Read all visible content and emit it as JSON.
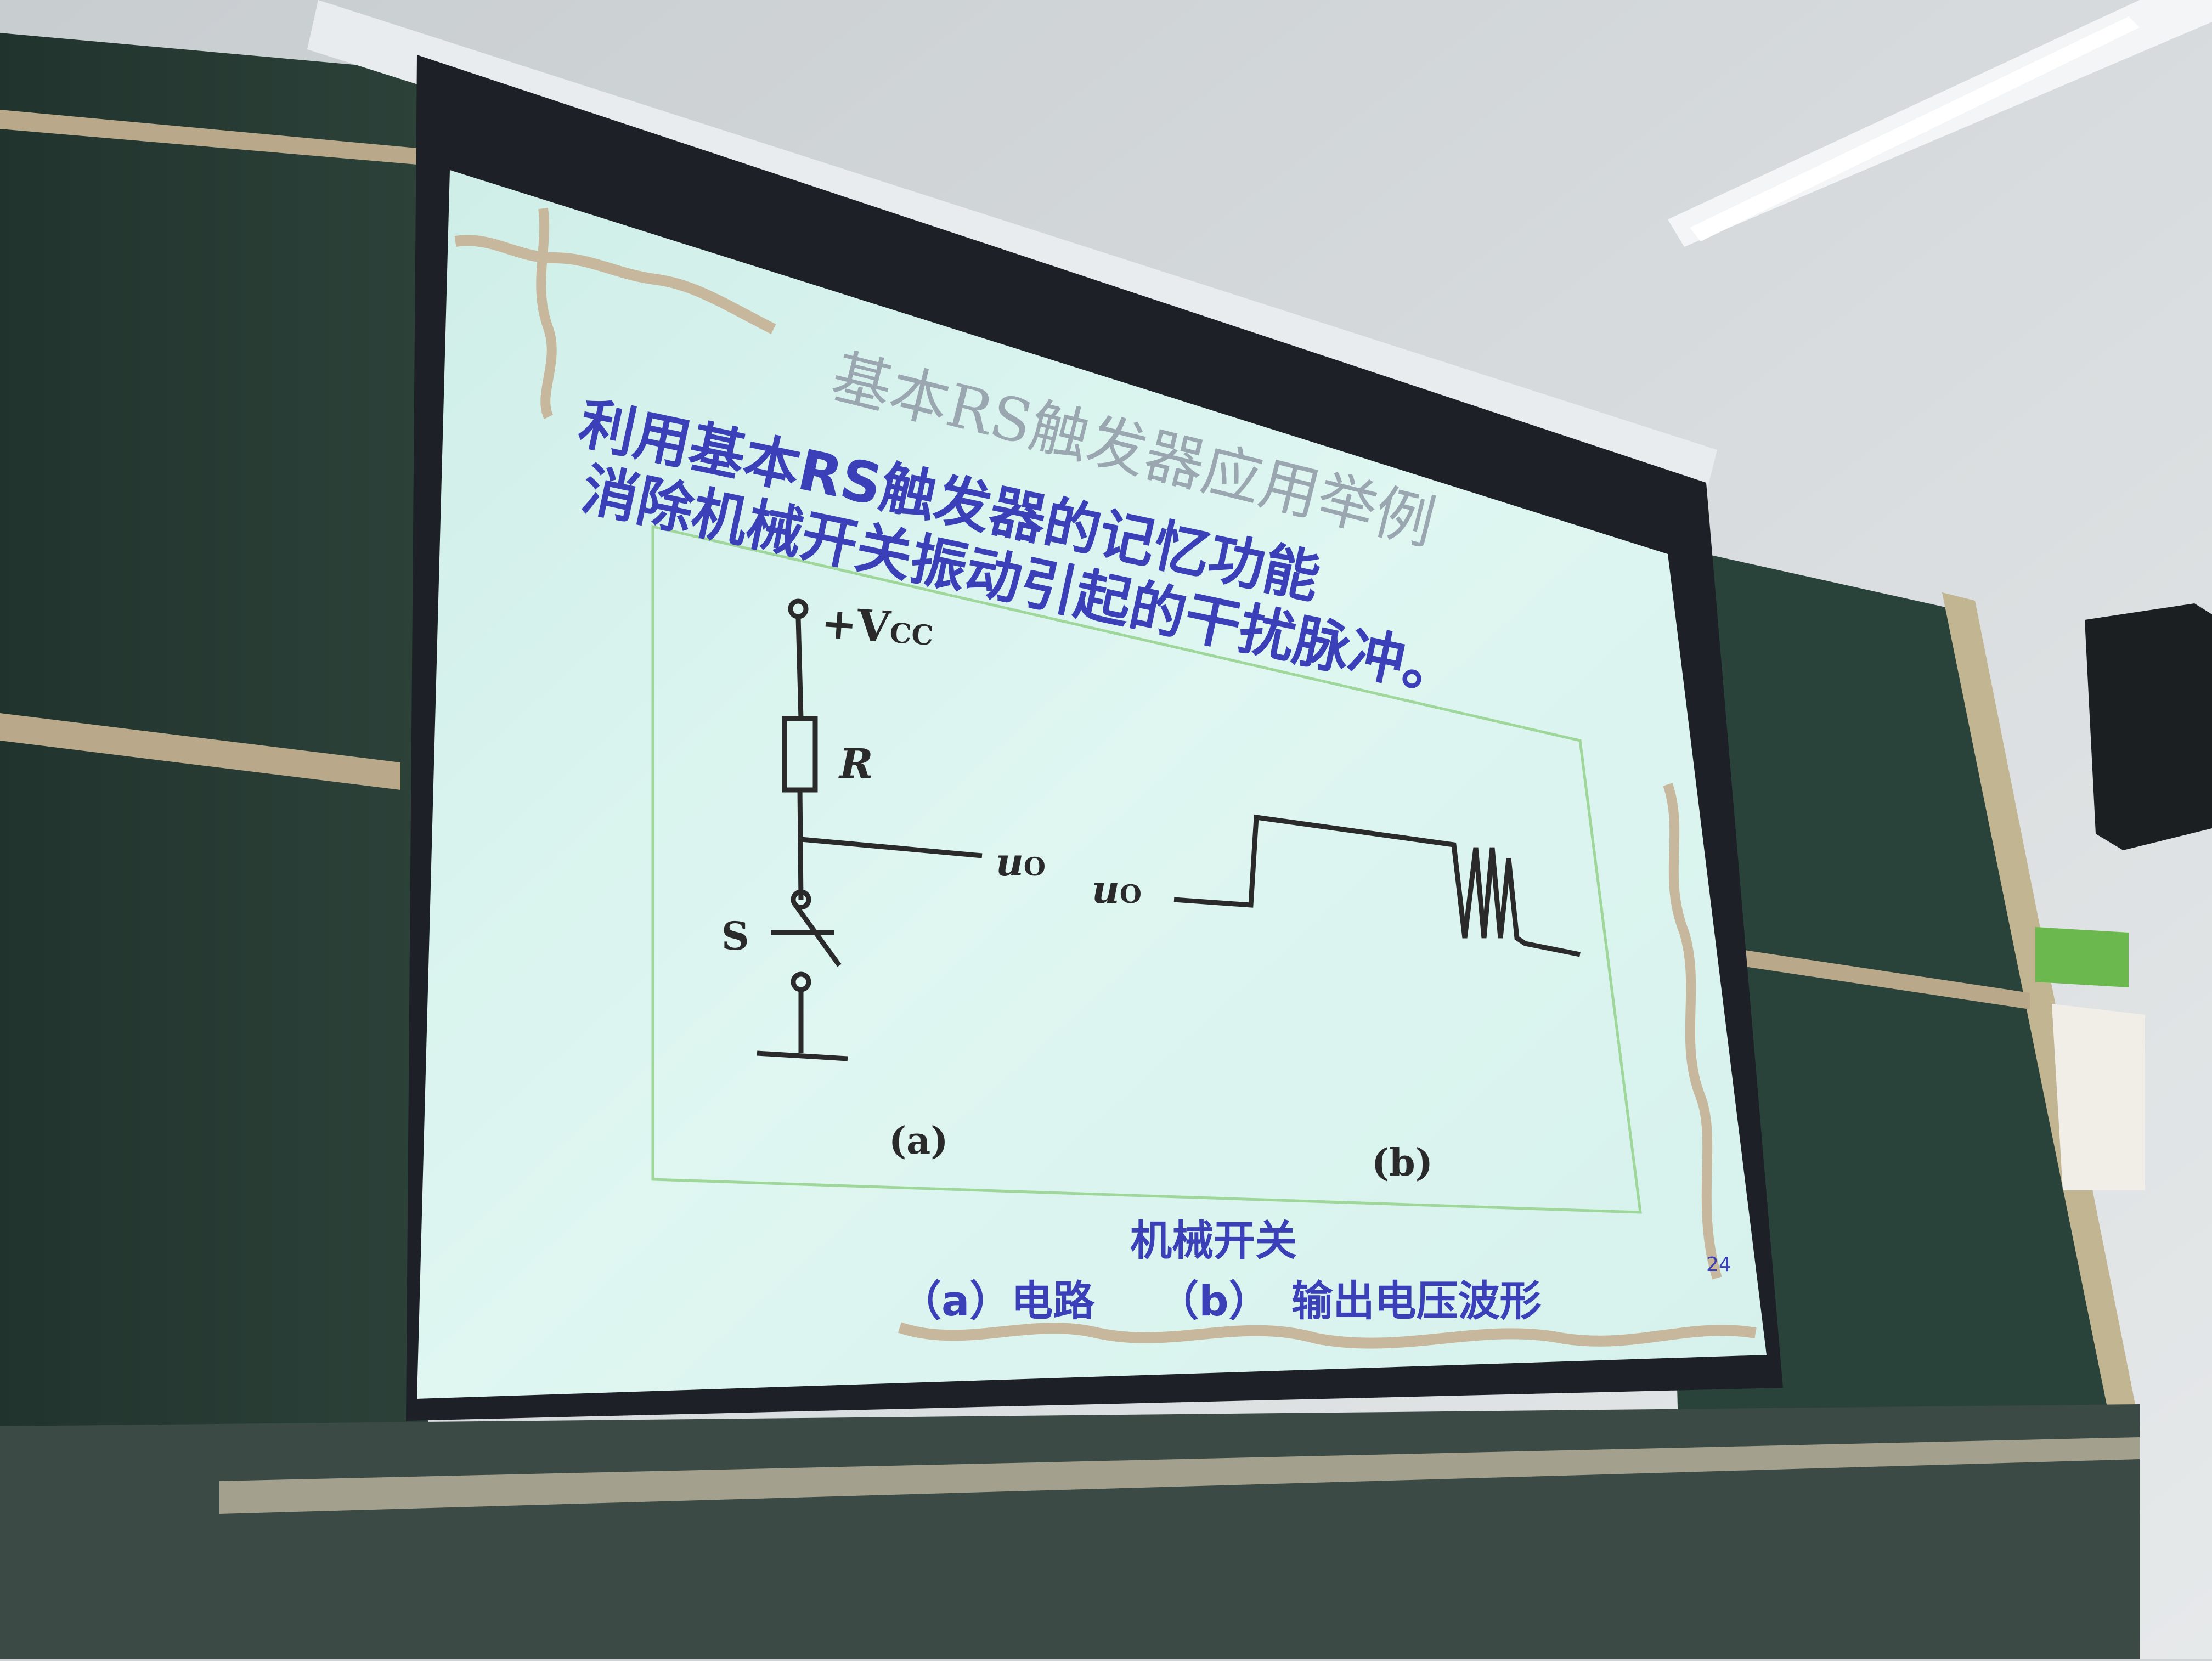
{
  "slide": {
    "title": "基本RS触发器应用举例",
    "intro_line1": "利用基本RS触发器的记忆功能",
    "intro_line2": "消除机械开关振动引起的干扰脉冲。",
    "page_number": "24",
    "caption_title": "机械开关",
    "caption_sub": "（a）电路　　（b）　输出电压波形"
  },
  "figure": {
    "label_vcc": "+V",
    "label_vcc_sub": "CC",
    "label_r": "R",
    "label_s": "S",
    "label_uo_a": "u",
    "label_uo_a_sub": "O",
    "label_uo_b": "u",
    "label_uo_b_sub": "O",
    "label_a": "(a)",
    "label_b": "(b)"
  },
  "colors": {
    "slide_bg": "#d9f2ec",
    "text_blue": "#3b3fb8",
    "title_gray": "#9aa7b0",
    "frame_green": "#9fd79a",
    "blackboard": "#253a33",
    "wall": "#d8dde0"
  }
}
